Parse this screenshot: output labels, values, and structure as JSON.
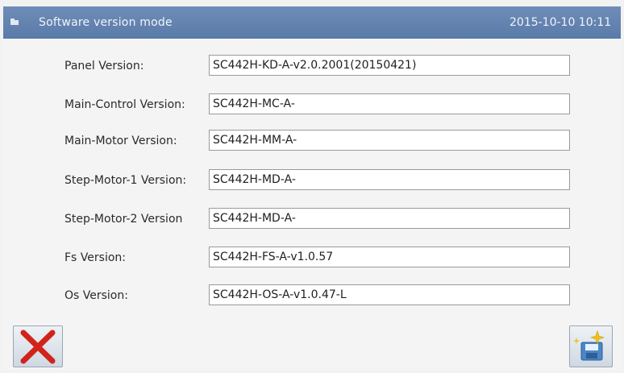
{
  "header": {
    "title": "Software version mode",
    "datetime": "2015-10-10 10:11"
  },
  "versions": [
    {
      "label": "Panel Version:",
      "value": "SC442H-KD-A-v2.0.2001(20150421)"
    },
    {
      "label": "Main-Control Version:",
      "value": "SC442H-MC-A-"
    },
    {
      "label": "Main-Motor Version:",
      "value": "SC442H-MM-A-"
    },
    {
      "label": "Step-Motor-1 Version:",
      "value": "SC442H-MD-A-"
    },
    {
      "label": "Step-Motor-2 Version",
      "value": "SC442H-MD-A-"
    },
    {
      "label": "Fs Version:",
      "value": "SC442H-FS-A-v1.0.57"
    },
    {
      "label": "Os Version:",
      "value": "SC442H-OS-A-v1.0.47-L"
    }
  ],
  "icons": {
    "title": "panel-icon",
    "cancel": "red-x-icon",
    "save": "save-sparkle-icon"
  },
  "colors": {
    "titlebar": "#5f7fae",
    "cancel_x": "#d2231b"
  }
}
